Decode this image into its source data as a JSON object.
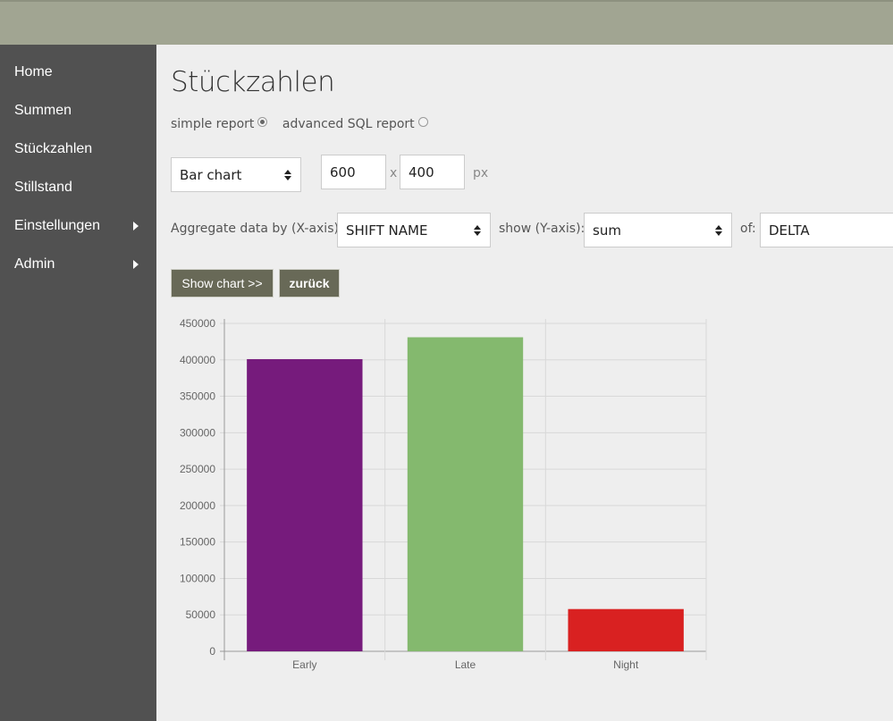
{
  "sidebar": {
    "items": [
      {
        "label": "Home",
        "submenu": false
      },
      {
        "label": "Summen",
        "submenu": false
      },
      {
        "label": "Stückzahlen",
        "submenu": false
      },
      {
        "label": "Stillstand",
        "submenu": false
      },
      {
        "label": "Einstellungen",
        "submenu": true
      },
      {
        "label": "Admin",
        "submenu": true
      }
    ]
  },
  "page": {
    "title": "Stückzahlen"
  },
  "report": {
    "simple_label": "simple report",
    "advanced_label": "advanced SQL report",
    "selected": "simple"
  },
  "form": {
    "chart_type": "Bar chart",
    "width": "600",
    "x_sep": "x",
    "height": "400",
    "unit": "px",
    "aggregate_label": "Aggregate data by (X-axis):",
    "aggregate_value": "SHIFT NAME",
    "show_label": "show (Y-axis):",
    "show_value": "sum",
    "of_label": "of:",
    "of_value": "DELTA",
    "show_chart_button": "Show chart >>",
    "back_button": "zurück"
  },
  "chart_data": {
    "type": "bar",
    "categories": [
      "Early",
      "Late",
      "Night"
    ],
    "values": [
      401000,
      431000,
      58000
    ],
    "colors": [
      "#761b7c",
      "#84b96e",
      "#d92121"
    ],
    "ylim": [
      0,
      450000
    ],
    "yticks": [
      0,
      50000,
      100000,
      150000,
      200000,
      250000,
      300000,
      350000,
      400000,
      450000
    ],
    "grid": true,
    "title": "",
    "xlabel": "",
    "ylabel": ""
  }
}
